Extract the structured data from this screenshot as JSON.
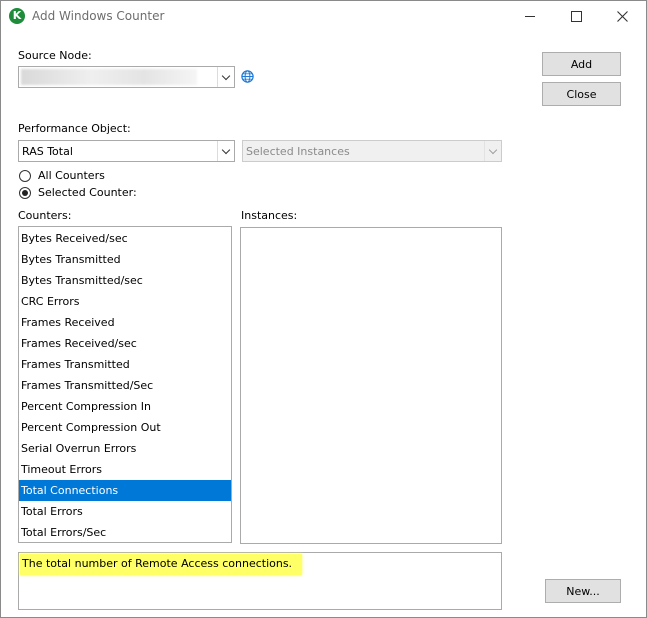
{
  "window": {
    "title": "Add Windows Counter",
    "app_icon_letter": "K"
  },
  "source_node": {
    "label": "Source Node:",
    "value": ""
  },
  "buttons": {
    "add": "Add",
    "close": "Close",
    "new": "New..."
  },
  "performance_object": {
    "label": "Performance Object:",
    "value": "RAS Total"
  },
  "instances_combo": {
    "value": "Selected Instances"
  },
  "radios": {
    "all_counters": "All Counters",
    "selected_counter": "Selected Counter:",
    "selected": "selected_counter"
  },
  "counters": {
    "label": "Counters:",
    "items": [
      "Bytes Received/sec",
      "Bytes Transmitted",
      "Bytes Transmitted/sec",
      "CRC Errors",
      "Frames Received",
      "Frames Received/sec",
      "Frames Transmitted",
      "Frames Transmitted/Sec",
      "Percent Compression In",
      "Percent Compression Out",
      "Serial Overrun Errors",
      "Timeout Errors",
      "Total Connections",
      "Total Errors",
      "Total Errors/Sec"
    ],
    "selected_index": 12
  },
  "instances": {
    "label": "Instances:",
    "items": []
  },
  "description": {
    "text": "The total number of Remote Access connections."
  },
  "colors": {
    "selection": "#0078d7",
    "highlight": "#ffff66",
    "app_icon": "#1e8c3a",
    "globe": "#1f7ad6"
  }
}
